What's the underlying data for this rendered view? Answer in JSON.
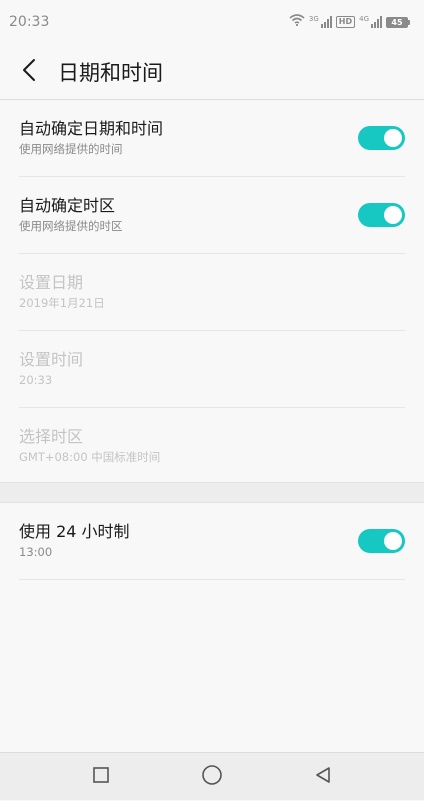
{
  "status_bar": {
    "time": "20:33",
    "sim1_tag": "3G",
    "hd_label": "HD",
    "sim2_tag": "4G",
    "battery_level": "45",
    "icons": [
      "wifi-icon",
      "signal-icon",
      "hd-icon",
      "signal-icon",
      "battery-icon"
    ]
  },
  "header": {
    "title": "日期和时间",
    "back_icon": "chevron-left-icon"
  },
  "section1": {
    "items": [
      {
        "title": "自动确定日期和时间",
        "subtitle": "使用网络提供的时间",
        "toggle": true,
        "enabled": true
      },
      {
        "title": "自动确定时区",
        "subtitle": "使用网络提供的时区",
        "toggle": true,
        "enabled": true
      },
      {
        "title": "设置日期",
        "subtitle": "2019年1月21日",
        "toggle": false,
        "enabled": false
      },
      {
        "title": "设置时间",
        "subtitle": "20:33",
        "toggle": false,
        "enabled": false
      },
      {
        "title": "选择时区",
        "subtitle": "GMT+08:00 中国标准时间",
        "toggle": false,
        "enabled": false
      }
    ]
  },
  "section2": {
    "items": [
      {
        "title": "使用 24 小时制",
        "subtitle": "13:00",
        "toggle": true,
        "enabled": true
      }
    ]
  },
  "colors": {
    "accent": "#16c7c2",
    "background": "#f8f8f8",
    "disabled_text": "#c4c4c4"
  },
  "nav_bar": {
    "icons": [
      "square-icon",
      "circle-icon",
      "triangle-back-icon"
    ]
  }
}
